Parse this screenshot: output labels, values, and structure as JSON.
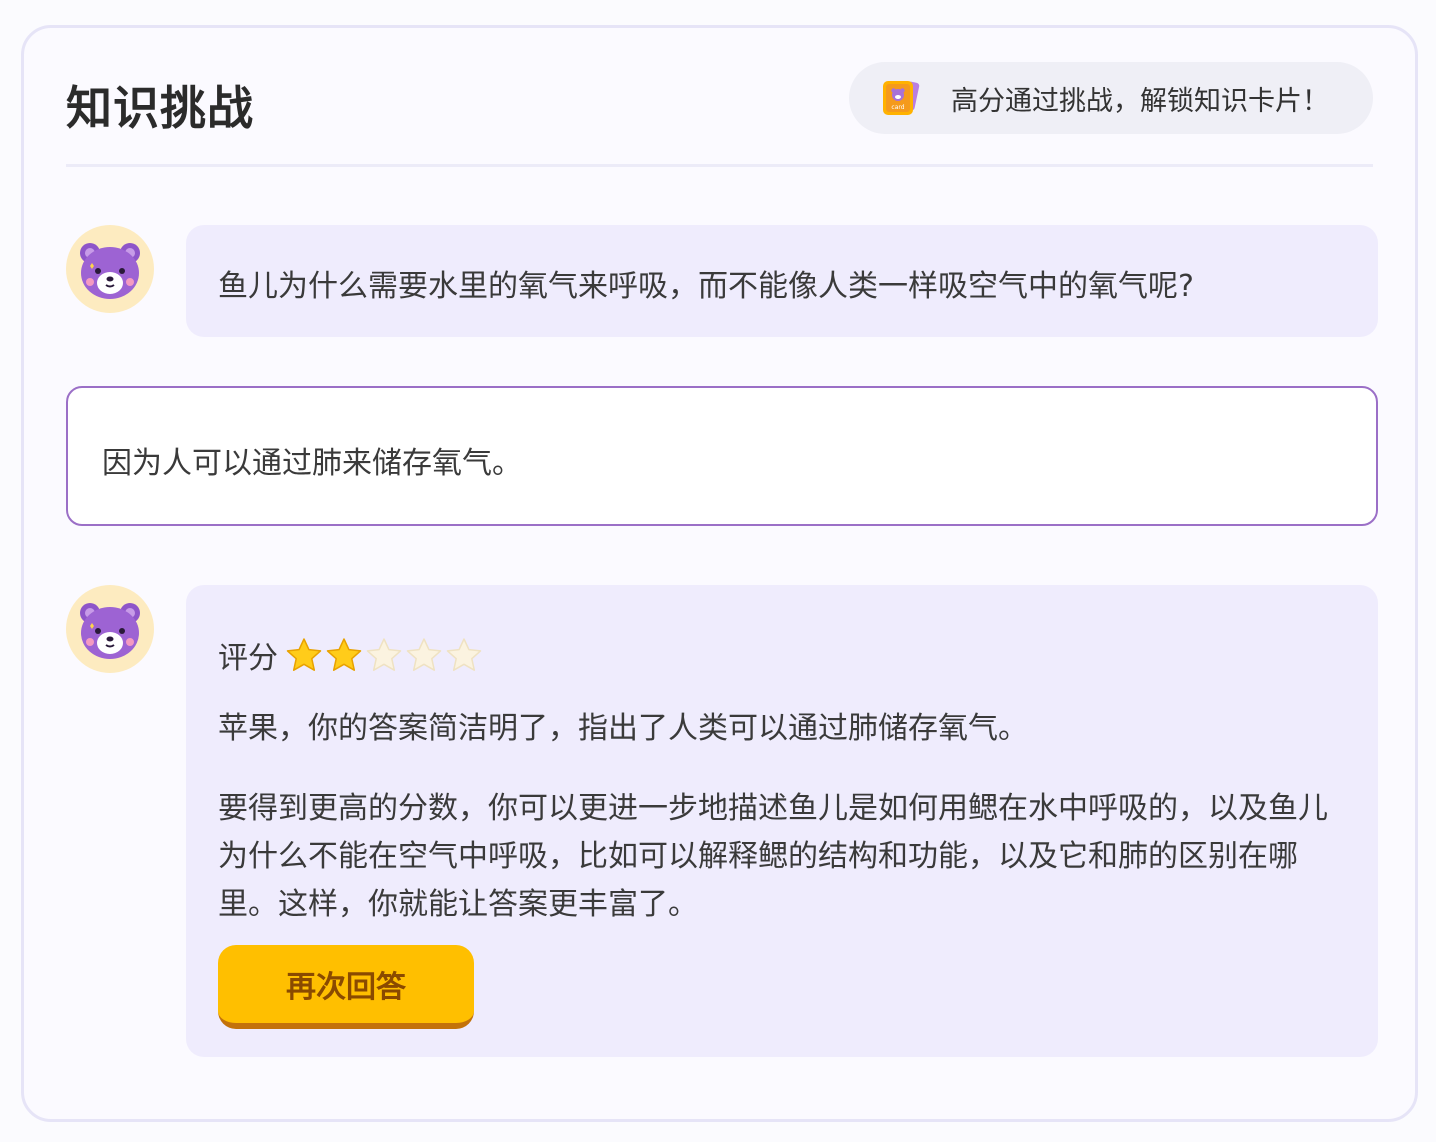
{
  "header": {
    "title": "知识挑战",
    "hint_text": "高分通过挑战，解锁知识卡片！",
    "hint_icon": "card-icon",
    "hint_icon_label": "card"
  },
  "question": {
    "avatar_icon": "bear-avatar-icon",
    "text": "鱼儿为什么需要水里的氧气来呼吸，而不能像人类一样吸空气中的氧气呢?"
  },
  "answer": {
    "text": "因为人可以通过肺来储存氧气。"
  },
  "feedback": {
    "avatar_icon": "bear-avatar-icon",
    "score_label": "评分",
    "rating": 2,
    "max_rating": 5,
    "comment": "苹果，你的答案简洁明了，指出了人类可以通过肺储存氧气。",
    "advice": "要得到更高的分数，你可以更进一步地描述鱼儿是如何用鳃在水中呼吸的，以及鱼儿为什么不能在空气中呼吸，比如可以解释鳃的结构和功能，以及它和肺的区别在哪里。这样，你就能让答案更丰富了。",
    "retry_label": "再次回答"
  },
  "colors": {
    "accent": "#ffbf00",
    "bubble": "#efecfd",
    "answer_border": "#9b6fc7",
    "avatar_bg": "#fdebc0",
    "bear": "#9d63d3"
  }
}
